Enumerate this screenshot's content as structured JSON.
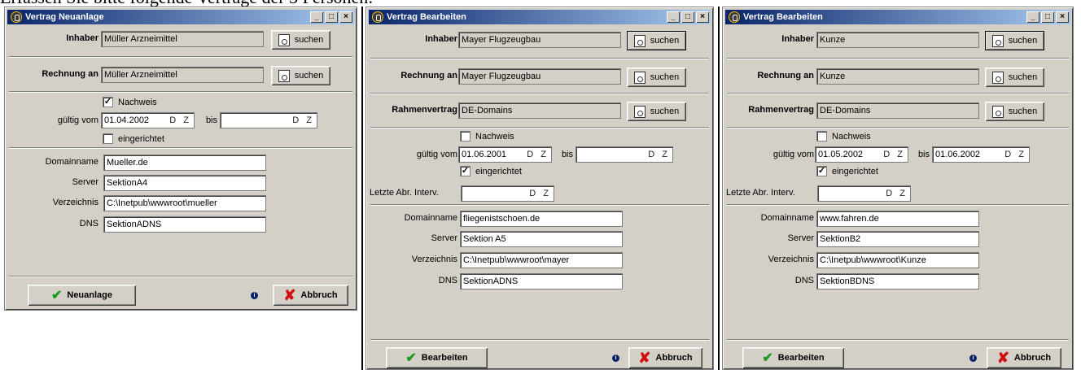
{
  "heading": "Erfassen Sie bitte folgende Verträge der 3 Personen:",
  "w1": {
    "title": "Vertrag Neuanlage",
    "inhaber_label": "Inhaber",
    "inhaber_value": "Müller Arzneimittel",
    "suchen": "suchen",
    "rechnung_label": "Rechnung an",
    "rechnung_value": "Müller Arzneimittel",
    "nachweis_label": "Nachweis",
    "nachweis_checked": true,
    "gueltig_label": "gültig vom",
    "gueltig_von": "01.04.2002",
    "dz": "D Z",
    "bis_label": "bis",
    "gueltig_bis": "",
    "eingerichtet_label": "eingerichtet",
    "eingerichtet_checked": false,
    "domainname_label": "Domainname",
    "domainname_value": "Mueller.de",
    "server_label": "Server",
    "server_value": "SektionA4",
    "verzeichnis_label": "Verzeichnis",
    "verzeichnis_value": "C:\\Inetpub\\wwwroot\\mueller",
    "dns_label": "DNS",
    "dns_value": "SektionADNS",
    "action_button": "Neuanlage",
    "cancel_button": "Abbruch"
  },
  "w2": {
    "title": "Vertrag Bearbeiten",
    "inhaber_label": "Inhaber",
    "inhaber_value": "Mayer Flugzeugbau",
    "suchen": "suchen",
    "rechnung_label": "Rechnung an",
    "rechnung_value": "Mayer Flugzeugbau",
    "rahmen_label": "Rahmenvertrag",
    "rahmen_value": "DE-Domains",
    "nachweis_label": "Nachweis",
    "nachweis_checked": false,
    "gueltig_label": "gültig vom",
    "gueltig_von": "01.06.2001",
    "dz": "D Z",
    "bis_label": "bis",
    "gueltig_bis": "",
    "eingerichtet_label": "eingerichtet",
    "eingerichtet_checked": true,
    "letzte_label": "Letzte Abr. Interv.",
    "letzte_value": "",
    "domainname_label": "Domainname",
    "domainname_value": "fliegenistschoen.de",
    "server_label": "Server",
    "server_value": "Sektion A5",
    "verzeichnis_label": "Verzeichnis",
    "verzeichnis_value": "C:\\Inetpub\\wwwroot\\mayer",
    "dns_label": "DNS",
    "dns_value": "SektionADNS",
    "action_button": "Bearbeiten",
    "cancel_button": "Abbruch"
  },
  "w3": {
    "title": "Vertrag Bearbeiten",
    "inhaber_label": "Inhaber",
    "inhaber_value": "Kunze",
    "suchen": "suchen",
    "rechnung_label": "Rechnung an",
    "rechnung_value": "Kunze",
    "rahmen_label": "Rahmenvertrag",
    "rahmen_value": "DE-Domains",
    "nachweis_label": "Nachweis",
    "nachweis_checked": false,
    "gueltig_label": "gültig vom",
    "gueltig_von": "01.05.2002",
    "dz": "D Z",
    "bis_label": "bis",
    "gueltig_bis": "01.06.2002",
    "eingerichtet_label": "eingerichtet",
    "eingerichtet_checked": true,
    "letzte_label": "Letzte Abr. Interv.",
    "letzte_value": "",
    "domainname_label": "Domainname",
    "domainname_value": "www.fahren.de",
    "server_label": "Server",
    "server_value": "SektionB2",
    "verzeichnis_label": "Verzeichnis",
    "verzeichnis_value": "C:\\Inetpub\\wwwroot\\Kunze",
    "dns_label": "DNS",
    "dns_value": "SektionBDNS",
    "action_button": "Bearbeiten",
    "cancel_button": "Abbruch"
  }
}
